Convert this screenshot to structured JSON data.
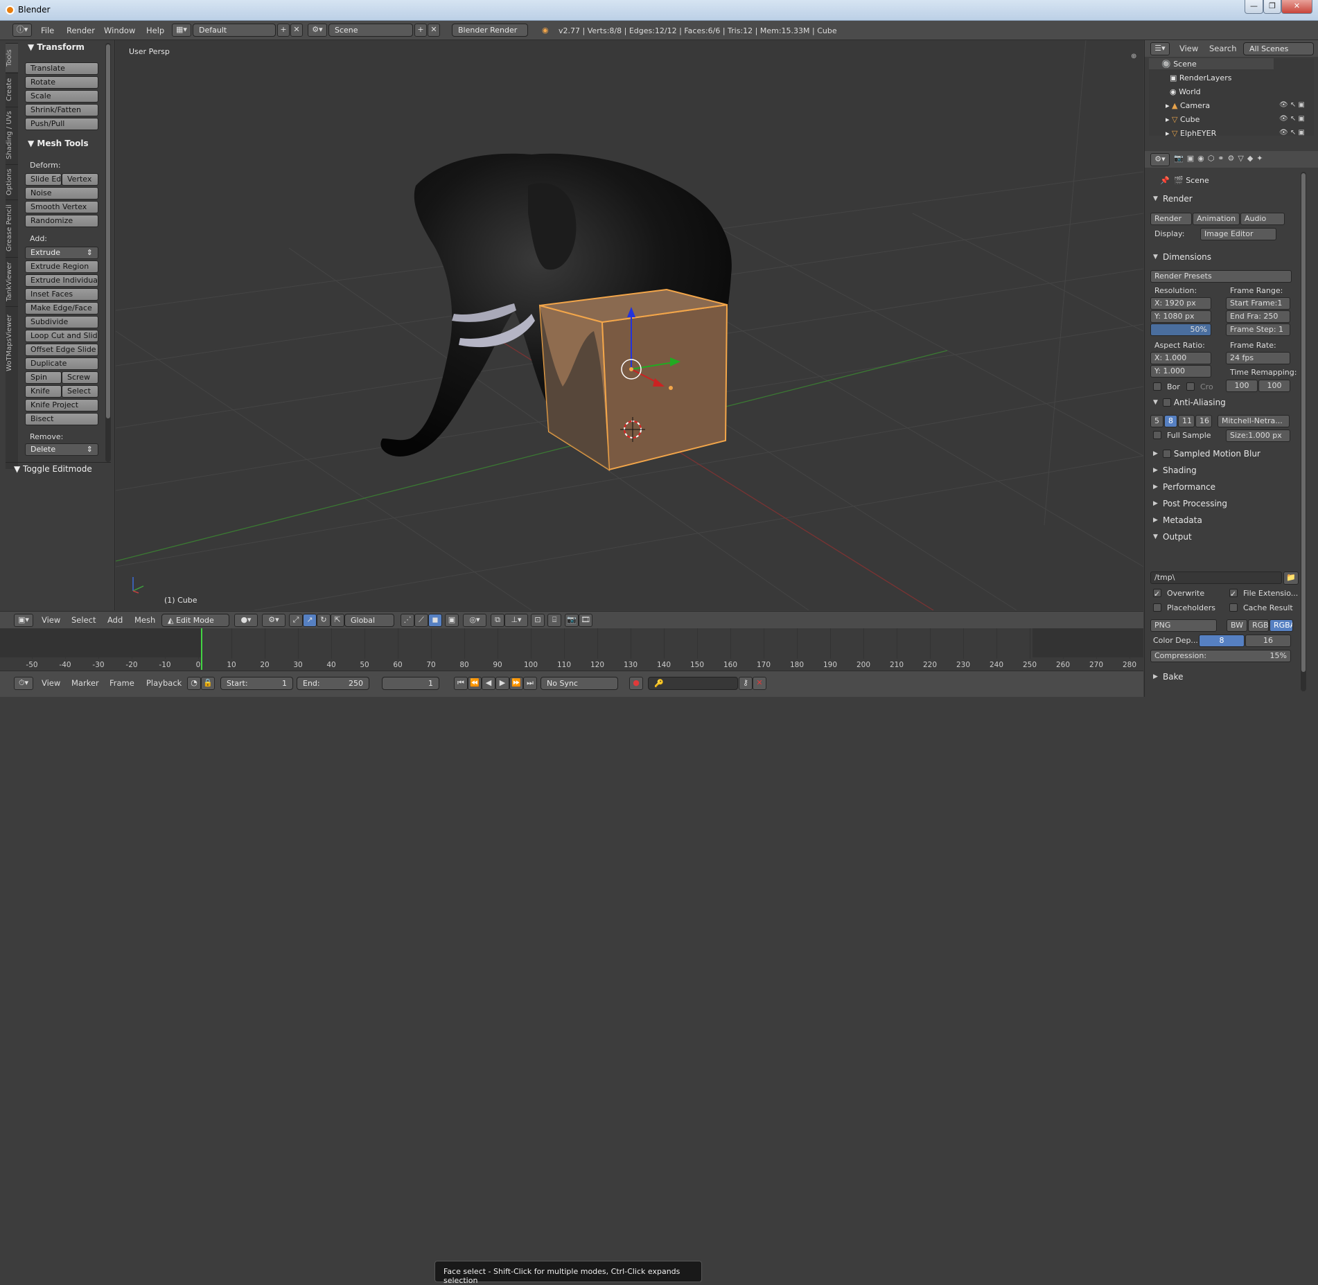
{
  "window": {
    "title": "Blender",
    "min": "—",
    "max": "❐",
    "close": "✕"
  },
  "infobar": {
    "menus": [
      "File",
      "Render",
      "Window",
      "Help"
    ],
    "layout": "Default",
    "scene": "Scene",
    "engine": "Blender Render",
    "stats": "v2.77 | Verts:8/8 | Edges:12/12 | Faces:6/6 | Tris:12 | Mem:15.33M | Cube"
  },
  "tool_tabs": [
    "Tools",
    "Create",
    "Shading / UVs",
    "Options",
    "Grease Pencil",
    "TankViewer",
    "WoTMapsViewer"
  ],
  "transform": {
    "title": "Transform",
    "buttons": [
      "Translate",
      "Rotate",
      "Scale",
      "Shrink/Fatten",
      "Push/Pull"
    ]
  },
  "mesh_tools": {
    "title": "Mesh Tools",
    "deform_label": "Deform:",
    "slide_edge": "Slide Ed",
    "vertex": "Vertex",
    "noise": "Noise",
    "smooth_vertex": "Smooth Vertex",
    "randomize": "Randomize",
    "add_label": "Add:",
    "extrude": "Extrude",
    "add_buttons": [
      "Extrude Region",
      "Extrude Individual",
      "Inset Faces",
      "Make Edge/Face",
      "Subdivide",
      "Loop Cut and Slide",
      "Offset Edge Slide",
      "Duplicate"
    ],
    "spin": "Spin",
    "screw": "Screw",
    "knife": "Knife",
    "select": "Select",
    "knife_project": "Knife Project",
    "bisect": "Bisect",
    "remove_label": "Remove:",
    "delete": "Delete"
  },
  "toggle_editmode": "Toggle Editmode",
  "viewport": {
    "persp_label": "User Persp",
    "object_label": "(1) Cube"
  },
  "outliner": {
    "view": "View",
    "search": "Search",
    "filter": "All Scenes",
    "items": [
      {
        "label": "Scene"
      },
      {
        "label": "RenderLayers"
      },
      {
        "label": "World"
      },
      {
        "label": "Camera"
      },
      {
        "label": "Cube"
      },
      {
        "label": "ElphEYER"
      }
    ]
  },
  "properties": {
    "scene_label": "Scene",
    "render": {
      "title": "Render",
      "render_btn": "Render",
      "animation_btn": "Animation",
      "audio_btn": "Audio",
      "display_label": "Display:",
      "display_value": "Image Editor"
    },
    "dimensions": {
      "title": "Dimensions",
      "presets": "Render Presets",
      "resolution_label": "Resolution:",
      "res_x": "X:",
      "res_x_val": "1920 px",
      "res_y": "Y:",
      "res_y_val": "1080 px",
      "res_pct": "50%",
      "frame_range_label": "Frame Range:",
      "start": "Start Frame:1",
      "end": "End Fra:  250",
      "step": "Frame Step: 1",
      "aspect_label": "Aspect Ratio:",
      "asp_x": "X:",
      "asp_x_val": "1.000",
      "asp_y": "Y:",
      "asp_y_val": "1.000",
      "frame_rate_label": "Frame Rate:",
      "frame_rate": "24 fps",
      "time_remap_label": "Time Remapping:",
      "remap_old": "100",
      "remap_new": "100",
      "border": "Bor",
      "crop": "Cro"
    },
    "aa": {
      "title": "Anti-Aliasing",
      "samples": [
        "5",
        "8",
        "11",
        "16"
      ],
      "filter": "Mitchell-Netra...",
      "full_sample": "Full Sample",
      "size": "Size:1.000 px"
    },
    "collapsed": [
      "Sampled Motion Blur",
      "Shading",
      "Performance",
      "Post Processing",
      "Metadata"
    ],
    "output": {
      "title": "Output",
      "path": "/tmp\\",
      "overwrite": "Overwrite",
      "file_ext": "File Extensio...",
      "placeholders": "Placeholders",
      "cache_result": "Cache Result",
      "format": "PNG",
      "bw": "BW",
      "rgb": "RGB",
      "rgba": "RGBA",
      "color_depth_label": "Color Dep...",
      "depth_8": "8",
      "depth_16": "16",
      "compression": "Compression:",
      "compression_val": "15%"
    },
    "bake": "Bake"
  },
  "view3d_header": {
    "menus": [
      "View",
      "Select",
      "Add",
      "Mesh"
    ],
    "mode": "Edit Mode",
    "orientation": "Global"
  },
  "timeline": {
    "tooltip": "Face select - Shift-Click for multiple modes, Ctrl-Click expands selection",
    "ticks": [
      "-50",
      "-40",
      "-30",
      "-20",
      "-10",
      "0",
      "10",
      "20",
      "30",
      "40",
      "50",
      "60",
      "70",
      "80",
      "90",
      "100",
      "110",
      "120",
      "130",
      "140",
      "150",
      "160",
      "170",
      "180",
      "190",
      "200",
      "210",
      "220",
      "230",
      "240",
      "250",
      "260",
      "270",
      "280"
    ],
    "current_frame": 0
  },
  "timebar": {
    "menus": [
      "View",
      "Marker",
      "Frame",
      "Playback"
    ],
    "start": "Start:",
    "start_val": "1",
    "end": "End:",
    "end_val": "250",
    "current": "1",
    "sync": "No Sync"
  },
  "colors": {
    "accent": "#5680c2",
    "select_orange": "#f3a64a",
    "bg": "#393939"
  }
}
